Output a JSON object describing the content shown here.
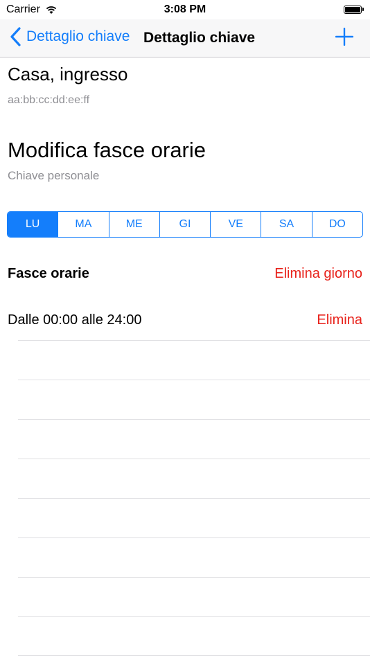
{
  "status_bar": {
    "carrier": "Carrier",
    "time": "3:08 PM",
    "wifi_icon": "wifi-icon",
    "battery_icon": "battery-icon",
    "battery_level": 1.0
  },
  "nav": {
    "back_label": "Dettaglio chiave",
    "title": "Dettaglio chiave",
    "back_icon": "chevron-left-icon",
    "add_icon": "plus-icon"
  },
  "key": {
    "name": "Casa, ingresso",
    "mac": "aa:bb:cc:dd:ee:ff"
  },
  "edit": {
    "title": "Modifica fasce orarie",
    "subtitle": "Chiave personale"
  },
  "days": {
    "items": [
      "LU",
      "MA",
      "ME",
      "GI",
      "VE",
      "SA",
      "DO"
    ],
    "selected": "LU"
  },
  "section": {
    "title": "Fasce orarie",
    "delete_day": "Elimina giorno"
  },
  "slots": [
    {
      "label": "Dalle 00:00 alle 24:00",
      "delete": "Elimina"
    }
  ],
  "colors": {
    "accent": "#147efb",
    "destructive": "#e8221b",
    "secondary_text": "#8e8e93"
  }
}
